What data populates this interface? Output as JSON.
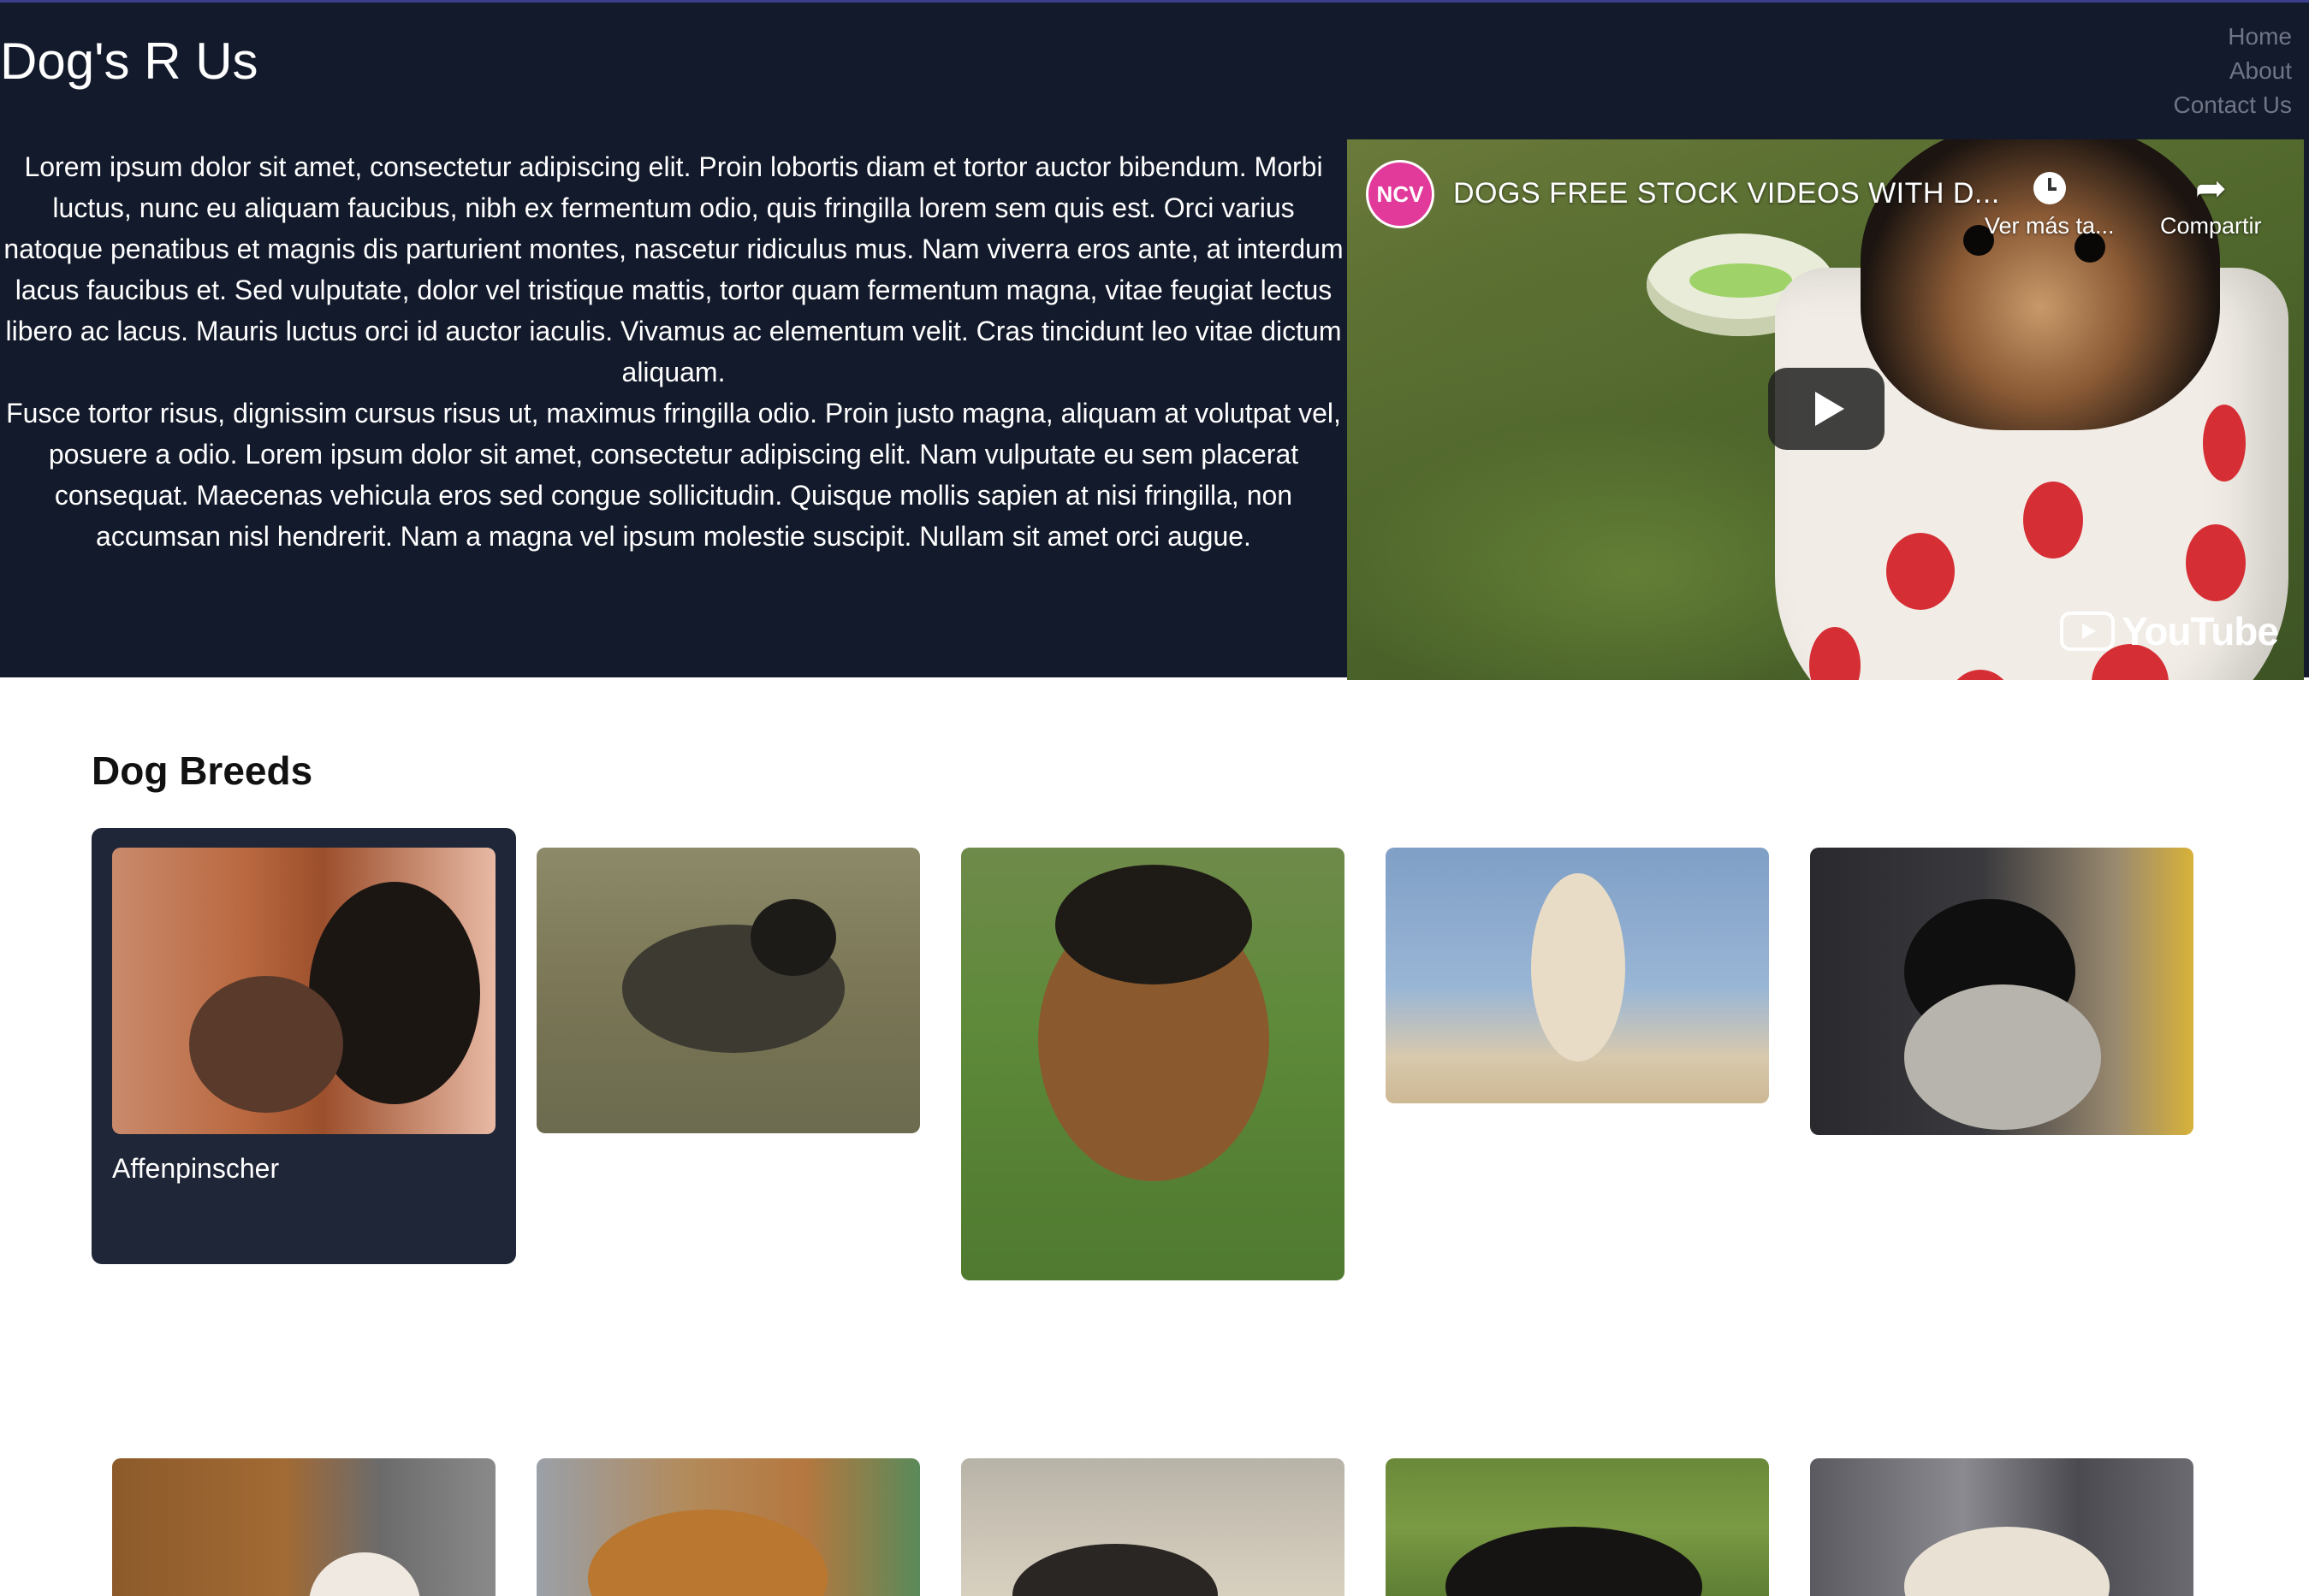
{
  "site": {
    "title": "Dog's R Us"
  },
  "nav": {
    "items": [
      "Home",
      "About",
      "Contact Us"
    ]
  },
  "intro": {
    "paragraphs": [
      "Lorem ipsum dolor sit amet, consectetur adipiscing elit. Proin lobortis diam et tortor auctor bibendum. Morbi luctus, nunc eu aliquam faucibus, nibh ex fermentum odio, quis fringilla lorem sem quis est. Orci varius natoque penatibus et magnis dis parturient montes, nascetur ridiculus mus. Nam viverra eros ante, at interdum lacus faucibus et. Sed vulputate, dolor vel tristique mattis, tortor quam fermentum magna, vitae feugiat lectus libero ac lacus. Mauris luctus orci id auctor iaculis. Vivamus ac elementum velit. Cras tincidunt leo vitae dictum aliquam.",
      "Fusce tortor risus, dignissim cursus risus ut, maximus fringilla odio. Proin justo magna, aliquam at volutpat vel, posuere a odio. Lorem ipsum dolor sit amet, consectetur adipiscing elit. Nam vulputate eu sem placerat consequat. Maecenas vehicula eros sed congue sollicitudin. Quisque mollis sapien at nisi fringilla, non accumsan nisl hendrerit. Nam a magna vel ipsum molestie suscipit. Nullam sit amet orci augue."
    ]
  },
  "video": {
    "channel_logo": "NCV",
    "title": "DOGS FREE STOCK VIDEOS WITH D...",
    "watch_later": "Ver más ta...",
    "share": "Compartir",
    "brand": "YouTube",
    "icons": {
      "watch_later": "clock-icon",
      "share": "share-arrow-icon",
      "play": "play-icon"
    }
  },
  "breeds": {
    "heading": "Dog Breeds",
    "selected_label": "Affenpinscher",
    "colors": {
      "card_bg": "#1f2638",
      "header_bg": "#131a2b"
    }
  }
}
